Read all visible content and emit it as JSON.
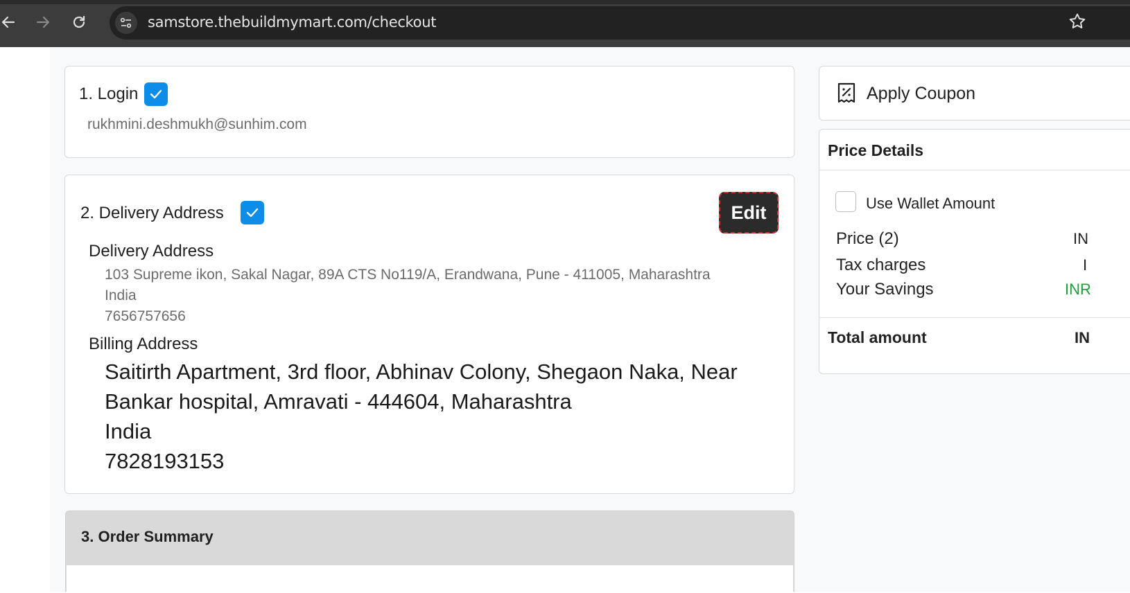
{
  "browser": {
    "url": "samstore.thebuildmymart.com/checkout"
  },
  "login": {
    "title": "1. Login",
    "email": "rukhmini.deshmukh@sunhim.com"
  },
  "delivery": {
    "title": "2. Delivery Address",
    "edit_label": "Edit",
    "delivery_heading": "Delivery Address",
    "delivery_line1": "103 Supreme ikon, Sakal Nagar, 89A CTS No119/A, Erandwana, Pune - 411005, Maharashtra",
    "delivery_country": "India",
    "delivery_phone": "7656757656",
    "billing_heading": "Billing Address",
    "billing_line1": "Saitirth Apartment, 3rd floor, Abhinav Colony, Shegaon Naka, Near",
    "billing_line2": "Bankar hospital, Amravati - 444604, Maharashtra",
    "billing_country": "India",
    "billing_phone": "7828193153"
  },
  "order_summary": {
    "title": "3. Order Summary"
  },
  "coupon": {
    "label": "Apply Coupon"
  },
  "price_details": {
    "title": "Price Details",
    "wallet_label": "Use Wallet Amount",
    "price_label": "Price (2)",
    "price_value": "IN",
    "tax_label": "Tax charges",
    "tax_value": "I",
    "savings_label": "Your Savings",
    "savings_value": "INR",
    "savings_color": "#1e9e3a",
    "total_label": "Total amount",
    "total_value": "IN"
  },
  "colors": {
    "check_blue": "#0d8de8",
    "edit_bg": "#2b2b2b",
    "edit_border": "#d32f2f"
  }
}
